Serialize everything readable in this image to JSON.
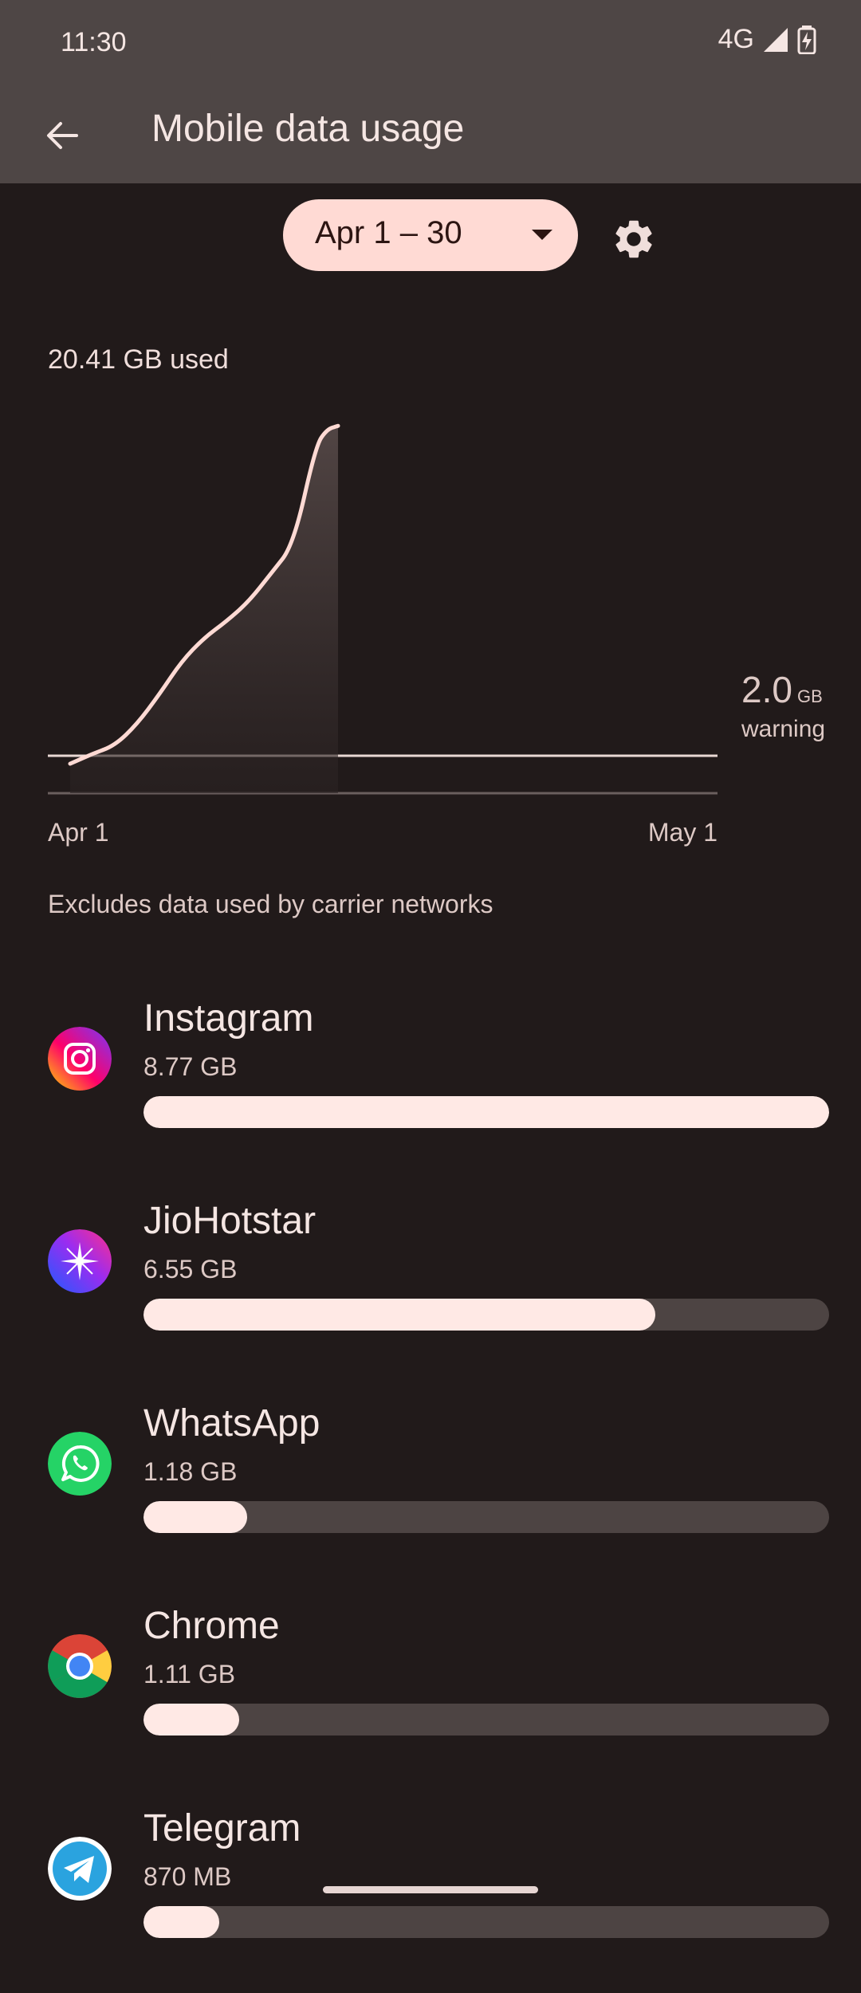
{
  "status_bar": {
    "time": "11:30",
    "network": "4G"
  },
  "header": {
    "title": "Mobile data usage",
    "back_icon": "arrow-back-icon"
  },
  "period": {
    "label": "Apr 1 – 30",
    "settings_icon": "gear-icon"
  },
  "usage": {
    "total": "20.41 GB used"
  },
  "chart_data": {
    "type": "area",
    "x_start_label": "Apr 1",
    "x_end_label": "May 1",
    "warning_value": "2.0",
    "warning_unit": "GB",
    "warning_label": "warning",
    "x_days": [
      1,
      2,
      3,
      4,
      5,
      6,
      7,
      8,
      9,
      10,
      11,
      12,
      12.5,
      13
    ],
    "cumulative_gb": [
      0,
      0.6,
      1.1,
      2.4,
      4.2,
      6.2,
      7.6,
      8.6,
      9.8,
      11.5,
      13.2,
      19.2,
      20.2,
      20.41
    ],
    "y_max_gb": 21,
    "line_color": "#ffdad4"
  },
  "note": "Excludes data used by carrier networks",
  "apps": [
    {
      "name": "Instagram",
      "size": "8.77 GB",
      "fraction": 1.0,
      "icon": "instagram-icon"
    },
    {
      "name": "JioHotstar",
      "size": "6.55 GB",
      "fraction": 0.747,
      "icon": "jiohotstar-icon"
    },
    {
      "name": "WhatsApp",
      "size": "1.18 GB",
      "fraction": 0.151,
      "icon": "whatsapp-icon"
    },
    {
      "name": "Chrome",
      "size": "1.11 GB",
      "fraction": 0.14,
      "icon": "chrome-icon"
    },
    {
      "name": "Telegram",
      "size": "870 MB",
      "fraction": 0.11,
      "icon": "telegram-icon"
    }
  ]
}
